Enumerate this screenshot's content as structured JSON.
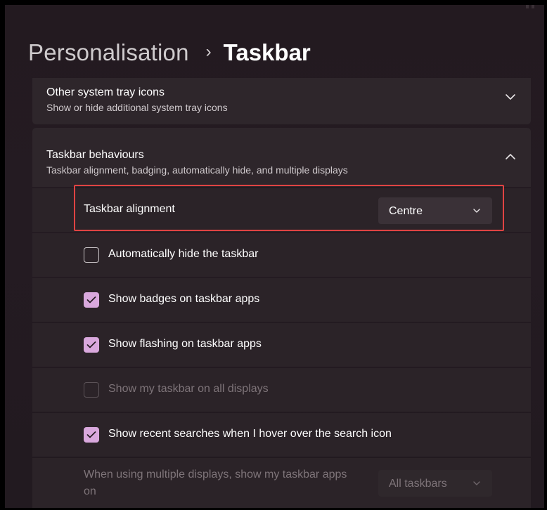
{
  "breadcrumb": {
    "parent": "Personalisation",
    "separator": "›",
    "current": "Taskbar"
  },
  "sections": {
    "tray_icons": {
      "title": "Other system tray icons",
      "subtitle": "Show or hide additional system tray icons",
      "expanded": false,
      "icon": "chevron-down-icon"
    },
    "behaviours": {
      "title": "Taskbar behaviours",
      "subtitle": "Taskbar alignment, badging, automatically hide, and multiple displays",
      "expanded": true,
      "icon": "chevron-up-icon"
    }
  },
  "alignment": {
    "label": "Taskbar alignment",
    "value": "Centre"
  },
  "options": {
    "auto_hide": {
      "label": "Automatically hide the taskbar",
      "checked": false,
      "enabled": true
    },
    "badges": {
      "label": "Show badges on taskbar apps",
      "checked": true,
      "enabled": true
    },
    "flashing": {
      "label": "Show flashing on taskbar apps",
      "checked": true,
      "enabled": true
    },
    "all_displays": {
      "label": "Show my taskbar on all displays",
      "checked": false,
      "enabled": false
    },
    "recent_searches": {
      "label": "Show recent searches when I hover over the search icon",
      "checked": true,
      "enabled": true
    }
  },
  "multi_display": {
    "label": "When using multiple displays, show my taskbar apps on",
    "value": "All taskbars",
    "enabled": false
  },
  "colors": {
    "accent_checkbox": "#d9a8dd",
    "highlight_border": "#e04343",
    "background": "#241b22",
    "card": "#2e262b"
  }
}
